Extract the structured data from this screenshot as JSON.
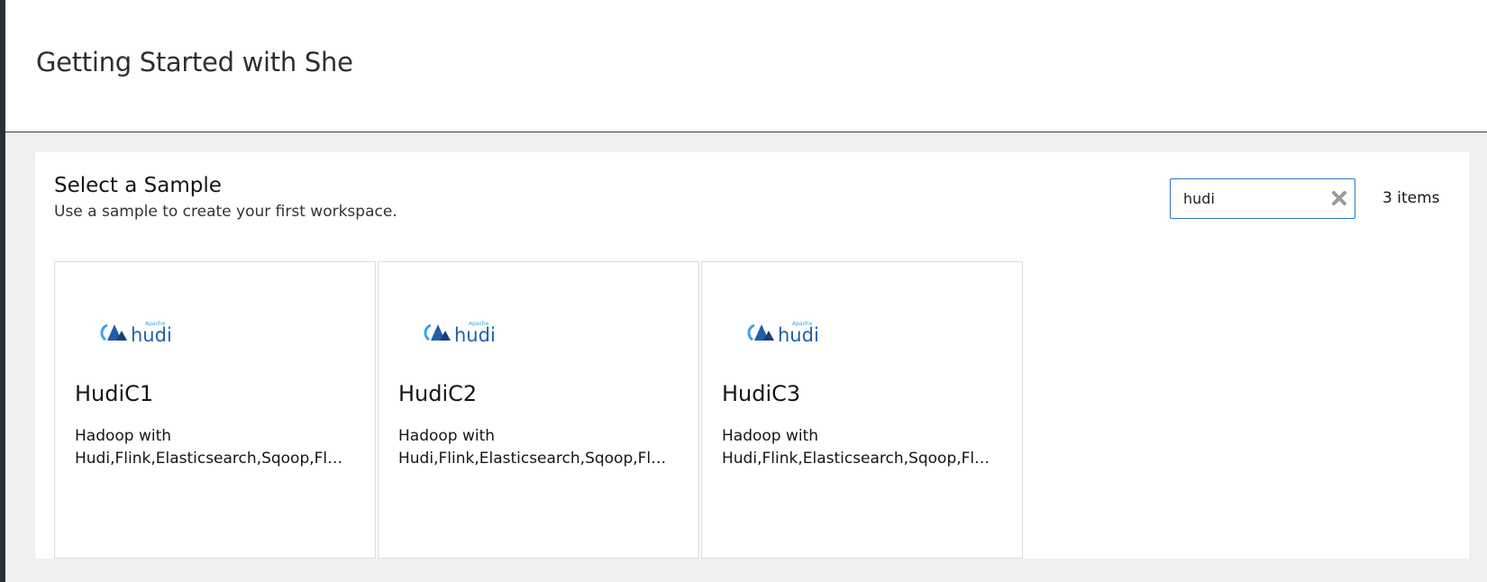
{
  "page": {
    "title": "Getting Started with She"
  },
  "sample_panel": {
    "title": "Select a Sample",
    "subtitle": "Use a sample to create your first workspace.",
    "search": {
      "value": "hudi",
      "placeholder": ""
    },
    "item_count": "3 items"
  },
  "cards": [
    {
      "name": "HudiC1",
      "desc_line1": "Hadoop with",
      "desc_line2": "Hudi,Flink,Elasticsearch,Sqoop,Flume",
      "logo_small": "Apache",
      "logo_text": "hudi"
    },
    {
      "name": "HudiC2",
      "desc_line1": "Hadoop with",
      "desc_line2": "Hudi,Flink,Elasticsearch,Sqoop,Flume",
      "logo_small": "Apache",
      "logo_text": "hudi"
    },
    {
      "name": "HudiC3",
      "desc_line1": "Hadoop with",
      "desc_line2": "Hudi,Flink,Elasticsearch,Sqoop,Flume",
      "logo_small": "Apache",
      "logo_text": "hudi"
    }
  ],
  "icons": {
    "clear": "close-icon",
    "logo": "apache-hudi-logo"
  },
  "colors": {
    "accent": "#2b78c5",
    "logo_blue": "#1f5fa8",
    "logo_light": "#3aa0e8",
    "background": "#f0f0f0"
  }
}
